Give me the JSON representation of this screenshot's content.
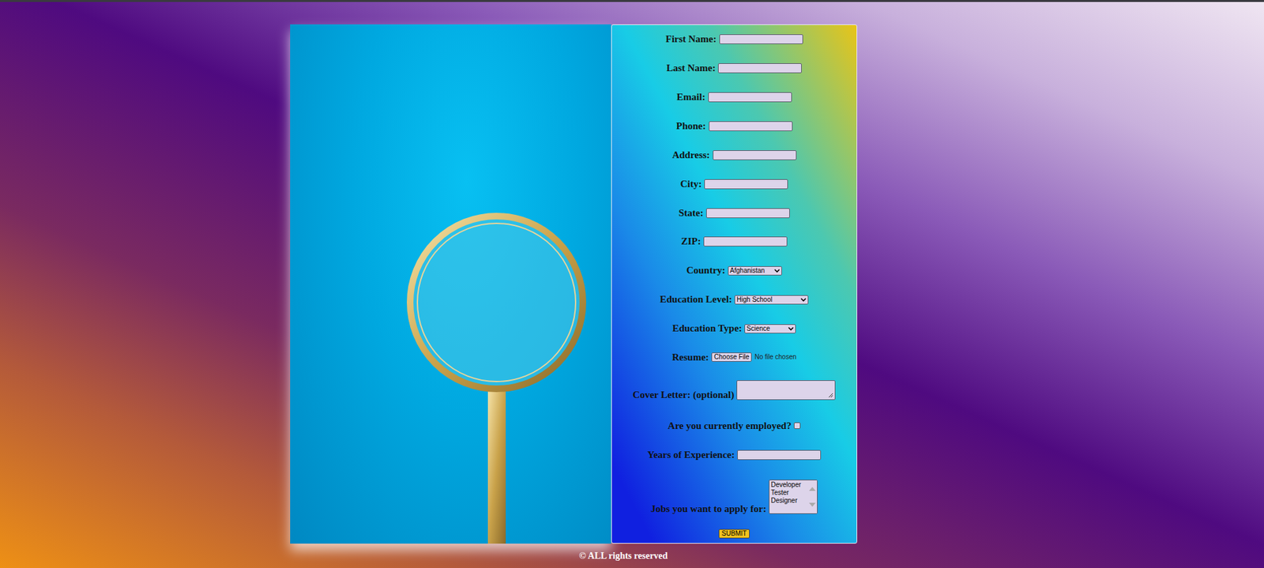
{
  "page": {
    "footer": "© ALL rights reserved"
  },
  "form": {
    "fields": [
      {
        "label": "First Name:",
        "kind": "text"
      },
      {
        "label": "Last Name:",
        "kind": "text"
      },
      {
        "label": "Email:",
        "kind": "text"
      },
      {
        "label": "Phone:",
        "kind": "text"
      },
      {
        "label": "Address:",
        "kind": "text"
      },
      {
        "label": "City:",
        "kind": "text"
      },
      {
        "label": "State:",
        "kind": "text"
      },
      {
        "label": "ZIP:",
        "kind": "text"
      },
      {
        "label": "Country:",
        "kind": "select",
        "value": "Afghanistan"
      },
      {
        "label": "Education Level:",
        "kind": "select",
        "value": "High School"
      },
      {
        "label": "Education Type:",
        "kind": "select",
        "value": "Science"
      },
      {
        "label": "Resume:",
        "kind": "file",
        "button": "Choose File",
        "status": "No file chosen"
      },
      {
        "label": "Cover Letter: (optional)",
        "kind": "textarea"
      },
      {
        "label": "Are you currently employed?",
        "kind": "checkbox",
        "checked": false
      },
      {
        "label": "Years of Experience:",
        "kind": "text"
      },
      {
        "label": "Jobs you want to apply for:",
        "kind": "listbox",
        "options": [
          "Developer",
          "Tester",
          "Designer"
        ]
      }
    ],
    "submit": "SUBMIT"
  }
}
